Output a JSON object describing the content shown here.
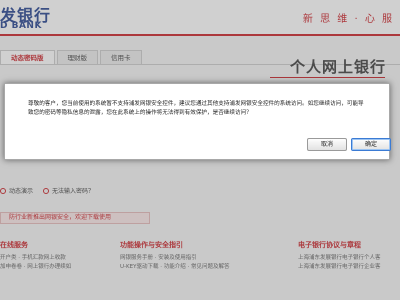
{
  "header": {
    "logo_cn": "发银行",
    "logo_en": "D BANK",
    "slogan": "新 思 维 · 心 服"
  },
  "nav": {
    "tabs": [
      "动态密码版",
      "理财版",
      "信用卡"
    ],
    "active_index": 0
  },
  "main": {
    "title": "个人网上银行",
    "links": [
      "动态演示",
      "无法输入密码？"
    ],
    "notice": "防行业新推出网银安全，欢迎下载使用"
  },
  "footer": {
    "col1": {
      "title": "在线服务",
      "rows": [
        "开户类 · 手机汇款网上收款",
        "加申卷卷 · 网上银行办理续如"
      ]
    },
    "col2": {
      "title": "功能操作与安全指引",
      "rows": [
        "网银服务手册 · 安装及使用指引",
        "U-KEY驱动下载 · 功能介绍 · 常见问题及解答"
      ]
    },
    "col3": {
      "title": "电子银行协议与章程",
      "rows": [
        "上海浦东发展银行电子银行个人客",
        "上海浦东发展银行电子银行企业客"
      ]
    }
  },
  "dialog": {
    "message": "尊敬的客户，您当前使用的系统暂不支持浦发网银安全控件，建议您通过其他支持浦发网银安全控件的系统访问。如您继续访问，可能导致您的密码等隐私信息的泄露，您在此系统上的操作将无法得到有效保护，是否继续访问？",
    "cancel_label": "取消",
    "ok_label": "确定"
  },
  "colors": {
    "brand_red": "#c8161d",
    "brand_blue": "#1b3a8a",
    "focus_blue": "#3b7bd4"
  }
}
